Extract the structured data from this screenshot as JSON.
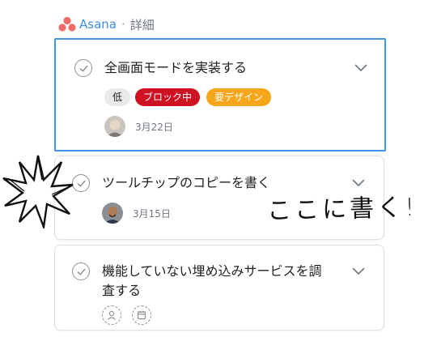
{
  "header": {
    "brand": "Asana",
    "separator": "·",
    "section": "詳細"
  },
  "tasks": [
    {
      "title": "全画面モードを実装する",
      "tags": [
        {
          "label": "低",
          "style": "low"
        },
        {
          "label": "ブロック中",
          "style": "red"
        },
        {
          "label": "要デザイン",
          "style": "orange"
        }
      ],
      "due": "3月22日",
      "selected": true
    },
    {
      "title": "ツールチップのコピーを書く",
      "due": "3月15日",
      "selected": false
    },
    {
      "title_line1": "機能していない埋め込みサービスを調",
      "title_line2": "査する",
      "due": "",
      "selected": false
    }
  ],
  "annotation": {
    "note": "ここに書く!",
    "burst_icon": "spiky-burst-doodle"
  },
  "colors": {
    "selection_border": "#3f94e6",
    "tag_red": "#cf1124",
    "tag_orange": "#f6a61a",
    "brand": "#3e8fe0",
    "logo": "#f06a6a"
  }
}
